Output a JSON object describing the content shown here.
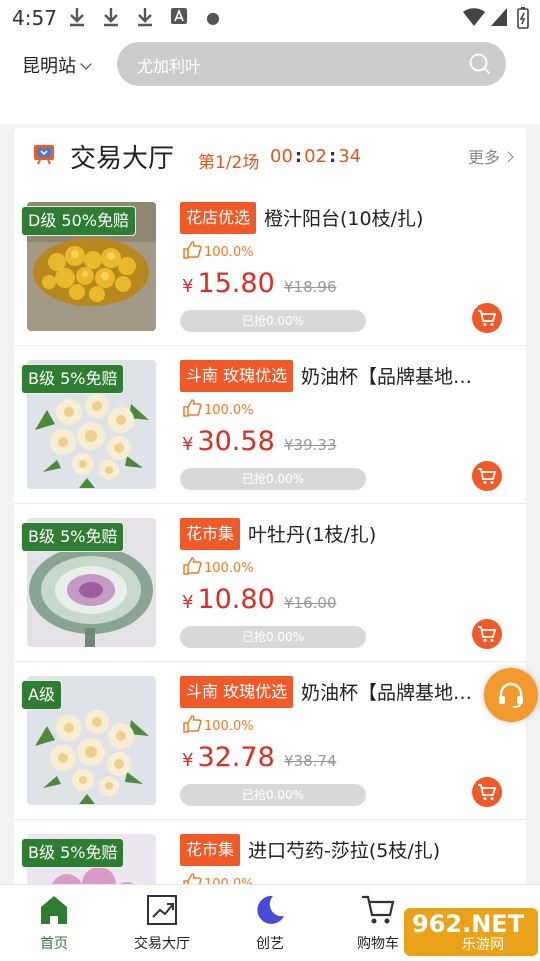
{
  "status": {
    "time": "4:57"
  },
  "header": {
    "city": "昆明站",
    "search_placeholder": "尤加利叶"
  },
  "section": {
    "title": "交易大厅",
    "session": "第1/2场",
    "countdown": [
      "00",
      "02",
      "34"
    ],
    "more": "更多"
  },
  "products": [
    {
      "grade": "D级 50%免赔",
      "tag": "花店优选",
      "name": "橙汁阳台(10枝/扎)",
      "like": "100.0%",
      "currency": "¥",
      "price": "15.80",
      "orig": "¥18.96",
      "sold": "已抢0.00%",
      "sold_fraction": 0.0,
      "image": "yellow-roses"
    },
    {
      "grade": "B级 5%免赔",
      "tag": "斗南 玫瑰优选",
      "name": "奶油杯【品牌基地…",
      "like": "100.0%",
      "currency": "¥",
      "price": "30.58",
      "orig": "¥39.33",
      "sold": "已抢0.00%",
      "sold_fraction": 0.0,
      "image": "cream-roses"
    },
    {
      "grade": "B级 5%免赔",
      "tag": "花市集",
      "name": "叶牡丹(1枝/扎)",
      "like": "100.0%",
      "currency": "¥",
      "price": "10.80",
      "orig": "¥16.00",
      "sold": "已抢0.00%",
      "sold_fraction": 0.0,
      "image": "ornamental-kale"
    },
    {
      "grade": "A级",
      "tag": "斗南 玫瑰优选",
      "name": "奶油杯【品牌基地…",
      "like": "100.0%",
      "currency": "¥",
      "price": "32.78",
      "orig": "¥38.74",
      "sold": "已抢0.00%",
      "sold_fraction": 0.0,
      "image": "cream-roses"
    },
    {
      "grade": "B级 5%免赔",
      "tag": "花市集",
      "name": "进口芍药-莎拉(5枝/扎)",
      "like": "100.0%",
      "currency": "¥",
      "price": "",
      "orig": "",
      "sold": "",
      "sold_fraction": 0.0,
      "image": "pink-peony"
    }
  ],
  "nav": [
    {
      "label": "首页",
      "icon": "home-icon",
      "active": true
    },
    {
      "label": "交易大厅",
      "icon": "trend-chart-icon",
      "active": false
    },
    {
      "label": "创艺",
      "icon": "moon-icon",
      "active": false
    },
    {
      "label": "购物车",
      "icon": "cart-icon",
      "active": false
    }
  ],
  "watermark": {
    "big": "962.NET",
    "small": "乐游网"
  },
  "colors": {
    "accent": "#f05a28",
    "grade_green": "#2f7d32",
    "price_red": "#e02b22",
    "search_bg": "#cccccc"
  }
}
